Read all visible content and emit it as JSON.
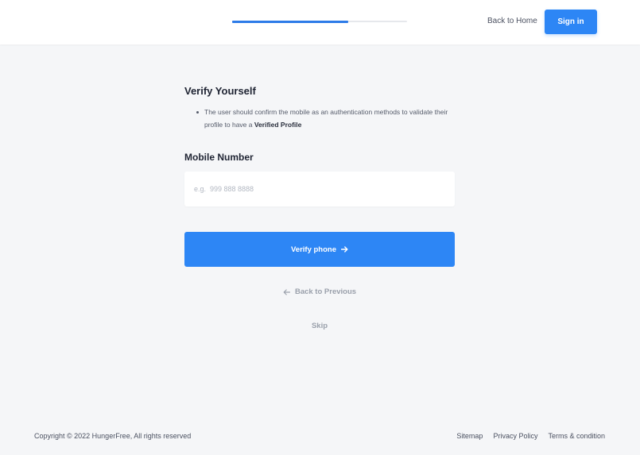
{
  "header": {
    "progress": 0.665,
    "back_home_label": "Back to Home",
    "signin_label": "Sign in"
  },
  "main": {
    "title": "Verify Yourself",
    "description_prefix": "The user should confirm the mobile as an authentication methods to validate their profile to have a ",
    "description_bold": "Verified Profile",
    "mobile_label": "Mobile Number",
    "phone_input": {
      "value": "",
      "placeholder": "e.g.  999 888 8888"
    },
    "verify_label": "Verify phone",
    "verify_icon": "arrow-right-icon",
    "back_prev_label": "Back to Previous",
    "back_prev_icon": "arrow-left-icon",
    "skip_label": "Skip"
  },
  "footer": {
    "copyright": "Copyright © 2022 HungerFree, All rights reserved",
    "links": [
      "Sitemap",
      "Privacy Policy",
      "Terms & condition"
    ]
  },
  "colors": {
    "accent": "#2d86f5",
    "background": "#f5f6f8",
    "muted": "#9aa0ab"
  }
}
